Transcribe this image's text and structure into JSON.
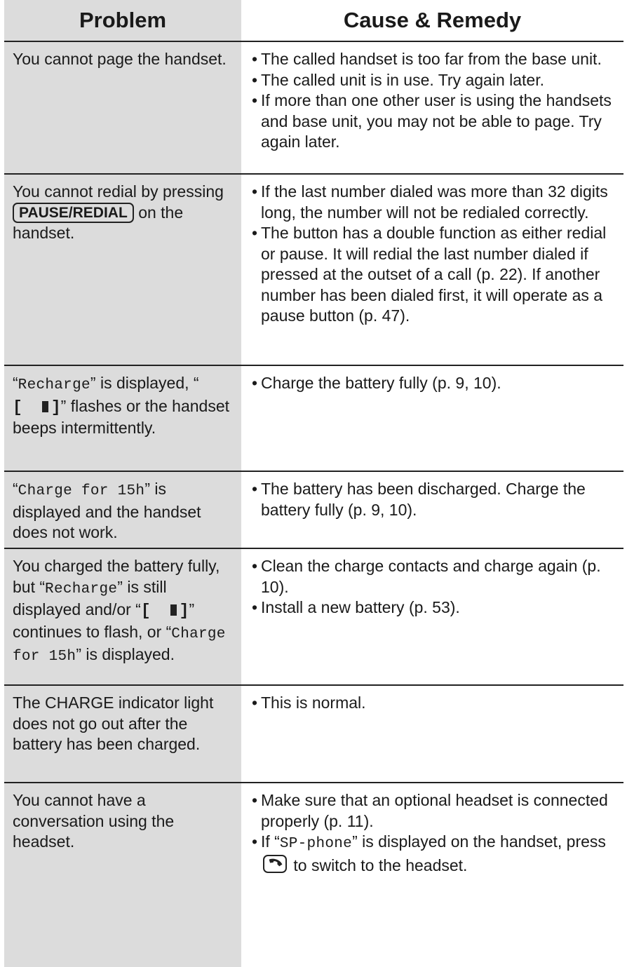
{
  "header": {
    "problem": "Problem",
    "cause_remedy": "Cause & Remedy"
  },
  "rows": [
    {
      "problem": "You cannot page the handset.",
      "remedies": [
        "The called handset is too far from the base unit.",
        "The called unit is in use. Try again later.",
        "If more than one other user is using the handsets and base unit, you may not be able to page. Try again later."
      ]
    },
    {
      "problem_before": "You cannot redial by pressing",
      "problem_key": "PAUSE/REDIAL",
      "problem_after": "on the handset.",
      "remedies": [
        "If the last number dialed was more than 32 digits long, the number will not be redialed correctly.",
        "The button has a double function as either redial or pause. It will redial the last number dialed if pressed at the outset of a call (p. 22). If another number has been dialed first, it will operate as a pause button (p. 47)."
      ]
    },
    {
      "display_recharge": "Recharge",
      "problem_part1": "is displayed,",
      "problem_part2": "flashes or the handset beeps intermittently.",
      "remedies": [
        "Charge the battery fully (p. 9, 10)."
      ]
    },
    {
      "display_charge": "Charge for 15h",
      "problem_rest": "is displayed and the handset does not work.",
      "remedies": [
        "The battery has been discharged. Charge the battery fully (p. 9, 10)."
      ]
    },
    {
      "problem_part1": "You charged the battery fully, but",
      "display_recharge": "Recharge",
      "problem_part2": "is still displayed and/or",
      "problem_part3": "continues to flash, or",
      "display_charge": "Charge for 15h",
      "problem_part4": "is displayed.",
      "remedies": [
        "Clean the charge contacts and charge again (p. 10).",
        "Install a new battery (p. 53)."
      ]
    },
    {
      "problem": "The CHARGE indicator light does not go out after the battery has been charged.",
      "remedies": [
        "This is normal."
      ]
    },
    {
      "problem": "You cannot have a conversation using the headset.",
      "remedy1": "Make sure that an optional headset is connected properly (p. 11).",
      "remedy2_before": "If",
      "remedy2_display": "SP-phone",
      "remedy2_mid": "is displayed on the handset, press",
      "remedy2_after": "to switch to the headset."
    }
  ],
  "icons": {
    "battery": "battery-low-icon",
    "talk": "talk-phone-icon"
  }
}
